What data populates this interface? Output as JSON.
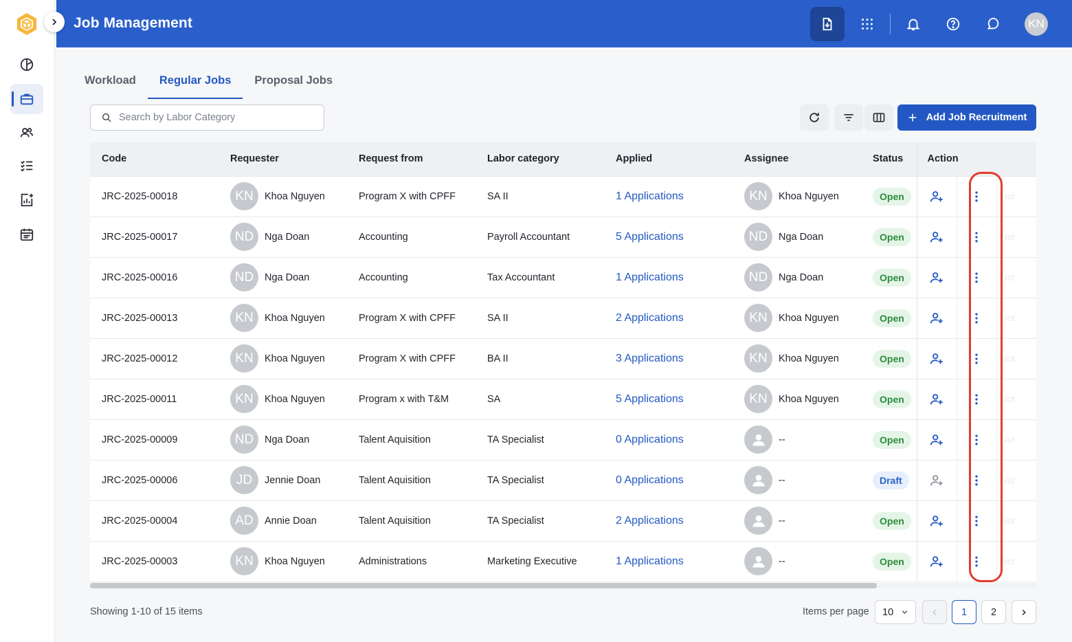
{
  "app": {
    "title": "Job Management"
  },
  "user": {
    "initials": "KN"
  },
  "sidebar": {
    "items": [
      {
        "name": "dashboard-icon"
      },
      {
        "name": "briefcase-icon",
        "active": true
      },
      {
        "name": "users-icon"
      },
      {
        "name": "checklist-icon"
      },
      {
        "name": "report-add-icon"
      },
      {
        "name": "calendar-icon"
      }
    ]
  },
  "header": {
    "actions": [
      "download-file-icon",
      "apps-grid-icon",
      "bell-icon",
      "help-icon",
      "chat-icon"
    ]
  },
  "tabs": [
    {
      "label": "Workload"
    },
    {
      "label": "Regular Jobs",
      "active": true
    },
    {
      "label": "Proposal Jobs"
    }
  ],
  "search": {
    "placeholder": "Search by Labor Category",
    "value": ""
  },
  "toolbar": {
    "add_label": "Add Job Recruitment"
  },
  "table": {
    "columns": [
      "Code",
      "Requester",
      "Request from",
      "Labor category",
      "Applied",
      "Assignee",
      "Status",
      "Action"
    ],
    "rows": [
      {
        "code": "JRC-2025-00018",
        "req_initials": "KN",
        "requester": "Khoa Nguyen",
        "from": "Program X with CPFF",
        "labor": "SA II",
        "applied": "1 Applications",
        "asg_initials": "KN",
        "assignee": "Khoa Nguyen",
        "status": "Open"
      },
      {
        "code": "JRC-2025-00017",
        "req_initials": "ND",
        "requester": "Nga Doan",
        "from": "Accounting",
        "labor": "Payroll Accountant",
        "applied": "5 Applications",
        "asg_initials": "ND",
        "assignee": "Nga Doan",
        "status": "Open"
      },
      {
        "code": "JRC-2025-00016",
        "req_initials": "ND",
        "requester": "Nga Doan",
        "from": "Accounting",
        "labor": "Tax Accountant",
        "applied": "1 Applications",
        "asg_initials": "ND",
        "assignee": "Nga Doan",
        "status": "Open"
      },
      {
        "code": "JRC-2025-00013",
        "req_initials": "KN",
        "requester": "Khoa Nguyen",
        "from": "Program X with CPFF",
        "labor": "SA II",
        "applied": "2 Applications",
        "asg_initials": "KN",
        "assignee": "Khoa Nguyen",
        "status": "Open"
      },
      {
        "code": "JRC-2025-00012",
        "req_initials": "KN",
        "requester": "Khoa Nguyen",
        "from": "Program X with CPFF",
        "labor": "BA II",
        "applied": "3 Applications",
        "asg_initials": "KN",
        "assignee": "Khoa Nguyen",
        "status": "Open"
      },
      {
        "code": "JRC-2025-00011",
        "req_initials": "KN",
        "requester": "Khoa Nguyen",
        "from": "Program x with T&M",
        "labor": "SA",
        "applied": "5 Applications",
        "asg_initials": "KN",
        "assignee": "Khoa Nguyen",
        "status": "Open"
      },
      {
        "code": "JRC-2025-00009",
        "req_initials": "ND",
        "requester": "Nga Doan",
        "from": "Talent Aquisition",
        "labor": "TA Specialist",
        "applied": "0 Applications",
        "asg_initials": "",
        "assignee": "--",
        "status": "Open"
      },
      {
        "code": "JRC-2025-00006",
        "req_initials": "JD",
        "requester": "Jennie Doan",
        "from": "Talent Aquisition",
        "labor": "TA Specialist",
        "applied": "0 Applications",
        "asg_initials": "",
        "assignee": "--",
        "status": "Draft"
      },
      {
        "code": "JRC-2025-00004",
        "req_initials": "AD",
        "requester": "Annie Doan",
        "from": "Talent Aquisition",
        "labor": "TA Specialist",
        "applied": "2 Applications",
        "asg_initials": "",
        "assignee": "--",
        "status": "Open"
      },
      {
        "code": "JRC-2025-00003",
        "req_initials": "KN",
        "requester": "Khoa Nguyen",
        "from": "Administrations",
        "labor": "Marketing Executive",
        "applied": "1 Applications",
        "asg_initials": "",
        "assignee": "--",
        "status": "Open"
      }
    ],
    "hidden_cell": "Not"
  },
  "pagination": {
    "showing": "Showing 1-10 of 15 items",
    "ipp_label": "Items per page",
    "ipp_value": "10",
    "pages": [
      "1",
      "2"
    ],
    "current": "1"
  },
  "colors": {
    "primary": "#2358c4",
    "header": "#2a5fcb",
    "open": "#2e8b3e",
    "highlight": "#e23b2b"
  }
}
